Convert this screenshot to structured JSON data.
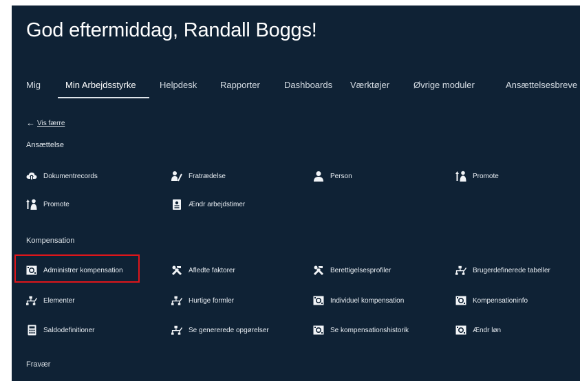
{
  "greeting": "God eftermiddag, Randall Boggs!",
  "tabs": [
    {
      "label": "Mig"
    },
    {
      "label": "Min Arbejdsstyrke"
    },
    {
      "label": "Helpdesk"
    },
    {
      "label": "Rapporter"
    },
    {
      "label": "Dashboards"
    },
    {
      "label": "Værktøjer"
    },
    {
      "label": "Øvrige moduler"
    },
    {
      "label": "Ansættelsesbreve"
    }
  ],
  "active_tab": "Min Arbejdsstyrke",
  "back_link": {
    "arrow": "←",
    "label": "Vis færre"
  },
  "sections": {
    "ansaettelse": {
      "title": "Ansættelse",
      "items": [
        {
          "label": "Dokumentrecords",
          "icon": "cloud-icon"
        },
        {
          "label": "Fratrædelse",
          "icon": "person-leave-icon"
        },
        {
          "label": "Person",
          "icon": "person-icon"
        },
        {
          "label": "Promote",
          "icon": "promote-icon"
        },
        {
          "label": "Promote",
          "icon": "promote-icon"
        },
        {
          "label": "Ændr arbejdstimer",
          "icon": "badge-icon"
        }
      ]
    },
    "kompensation": {
      "title": "Kompensation",
      "items": [
        {
          "label": "Administrer kompensation",
          "icon": "money-icon"
        },
        {
          "label": "Afledte faktorer",
          "icon": "tools-icon"
        },
        {
          "label": "Berettigelsesprofiler",
          "icon": "tools-icon"
        },
        {
          "label": "Brugerdefinerede tabeller",
          "icon": "org-chart-icon"
        },
        {
          "label": "Elementer",
          "icon": "org-chart-icon"
        },
        {
          "label": "Hurtige formler",
          "icon": "org-chart-icon"
        },
        {
          "label": "Individuel kompensation",
          "icon": "money-icon"
        },
        {
          "label": "Kompensationinfo",
          "icon": "money-icon"
        },
        {
          "label": "Saldodefinitioner",
          "icon": "calculator-icon"
        },
        {
          "label": "Se genererede opgørelser",
          "icon": "org-chart-icon"
        },
        {
          "label": "Se kompensationshistorik",
          "icon": "money-icon"
        },
        {
          "label": "Ændr løn",
          "icon": "money-icon"
        }
      ]
    },
    "fravaer": {
      "title": "Fravær"
    }
  },
  "highlight_color": "#e0161a",
  "background_color": "#0f2235"
}
